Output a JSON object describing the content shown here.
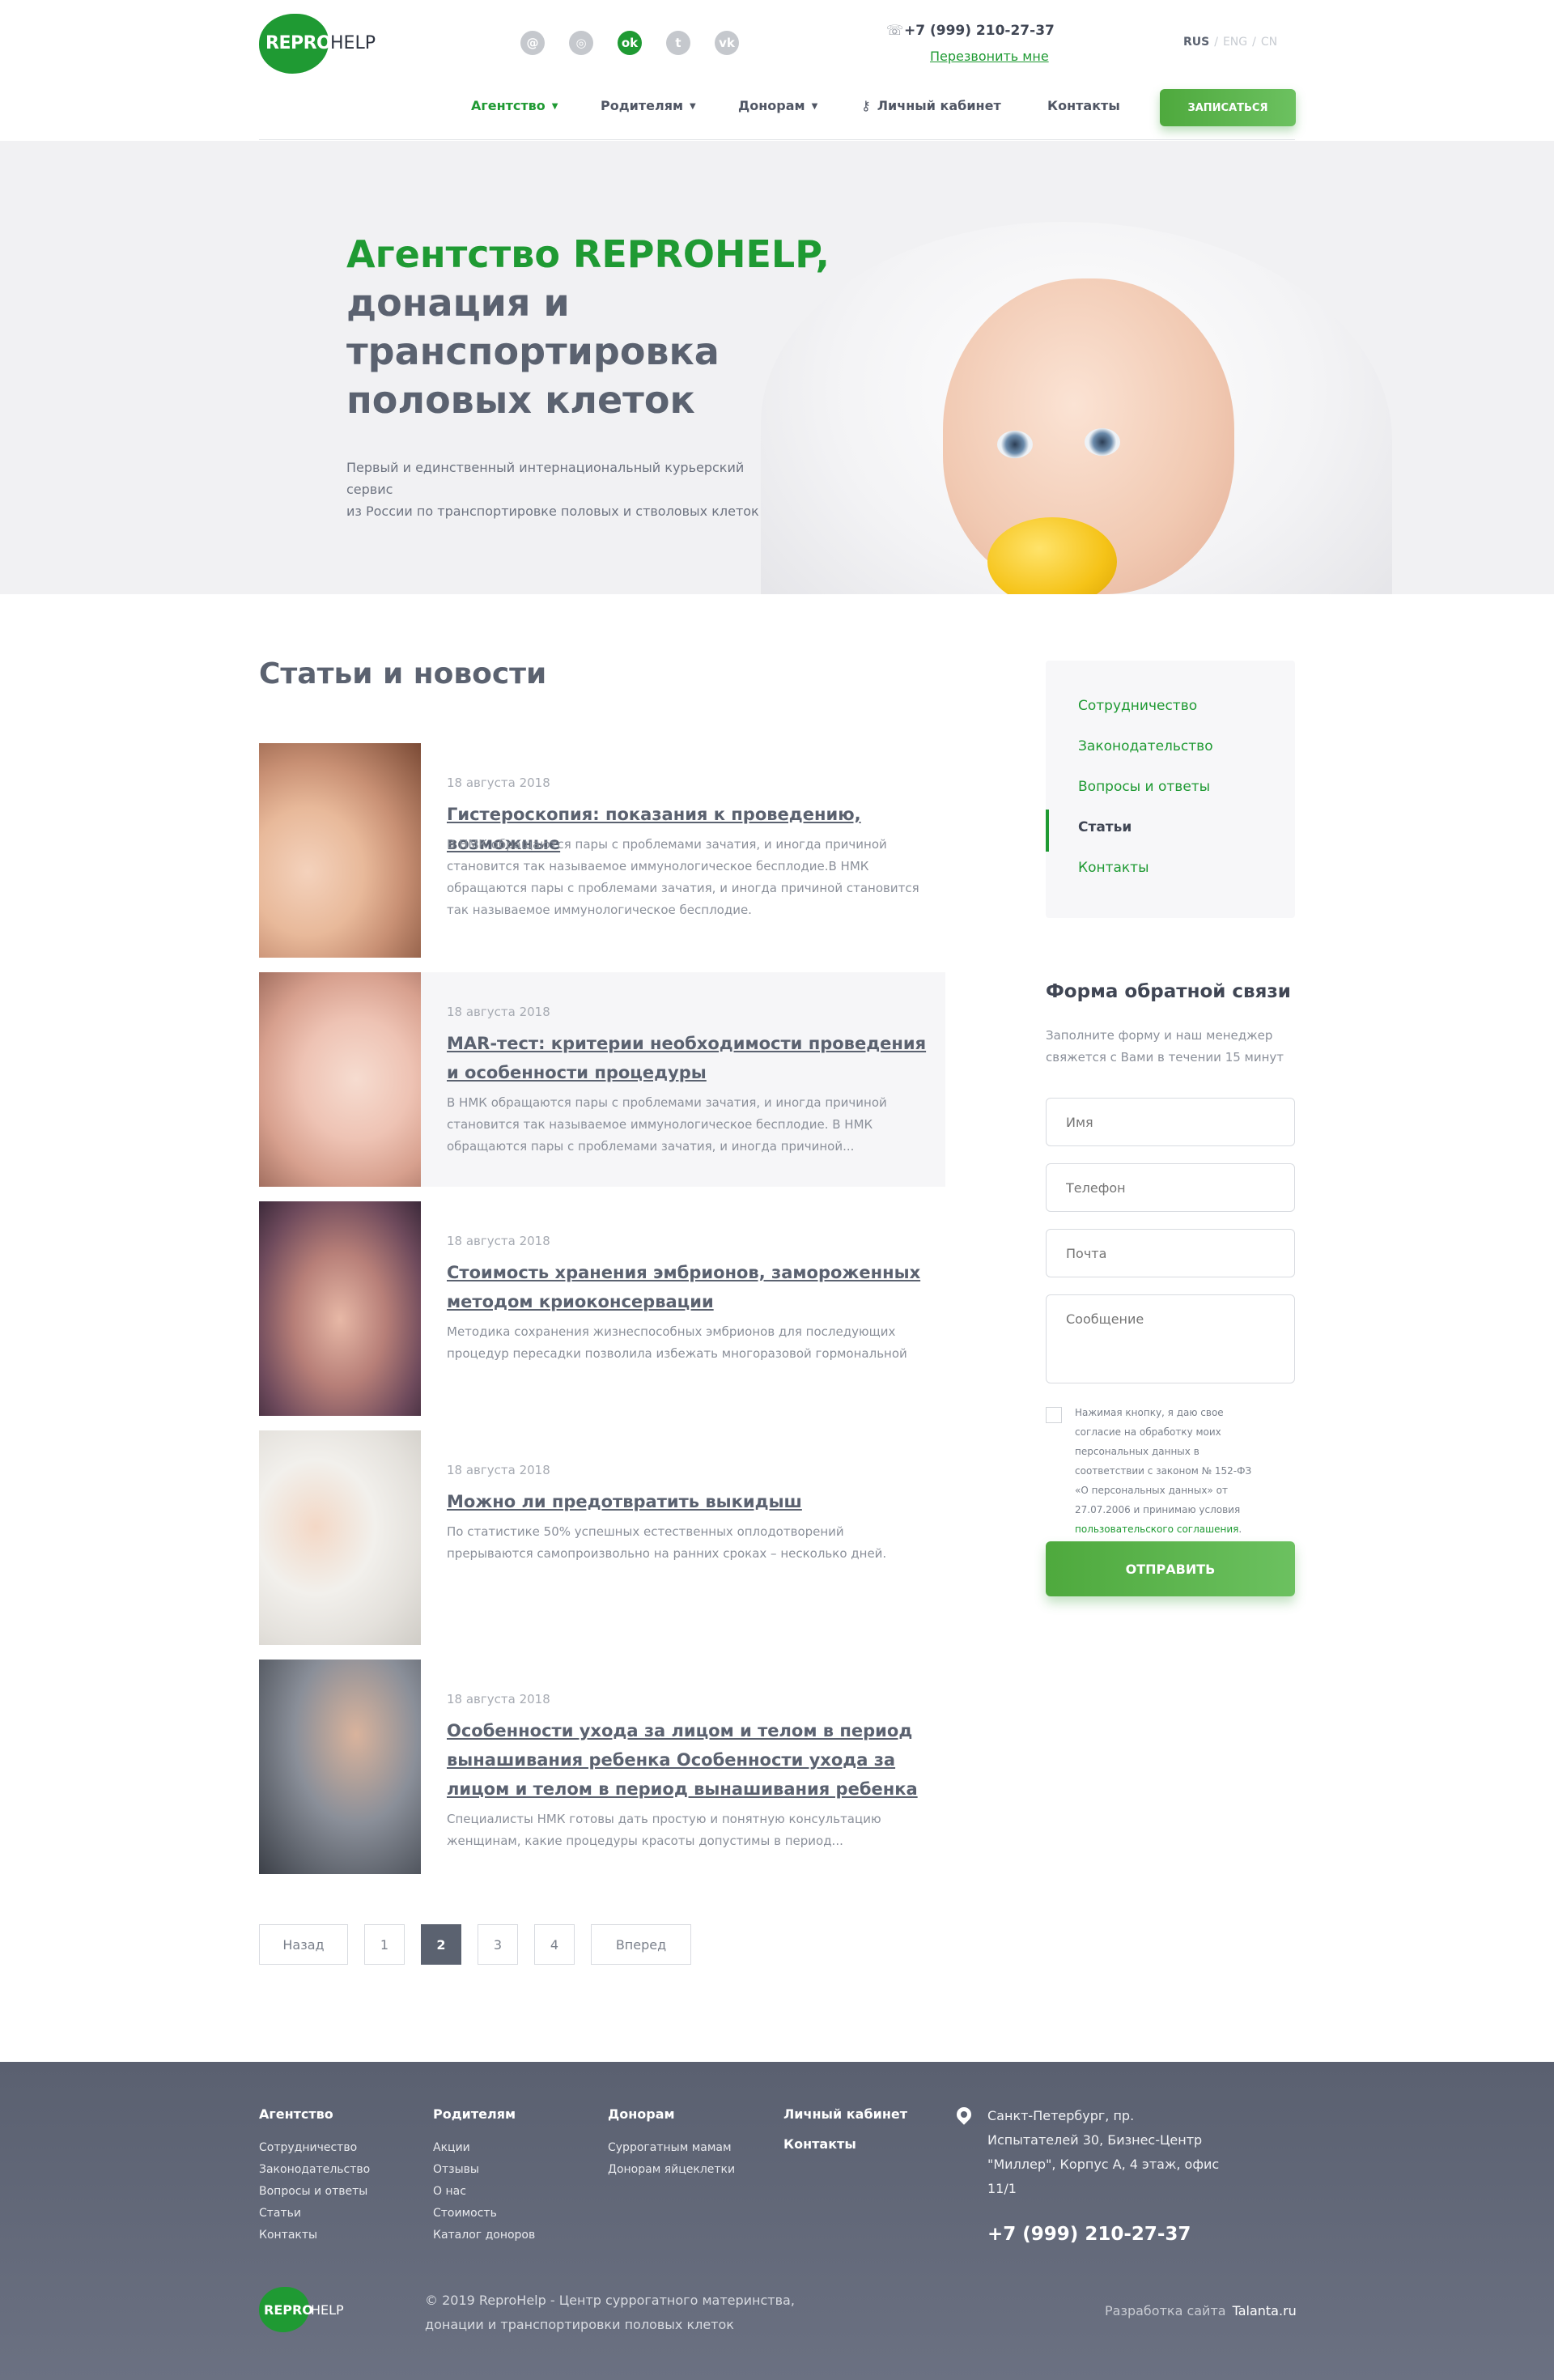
{
  "header": {
    "logo": {
      "repro": "REPRO",
      "help": "HELP"
    },
    "social": [
      {
        "icon": "at-icon",
        "glyph": "@",
        "active": false
      },
      {
        "icon": "instagram-icon",
        "glyph": "◎",
        "active": false
      },
      {
        "icon": "odnoklassniki-icon",
        "glyph": "ok",
        "active": true
      },
      {
        "icon": "twitter-icon",
        "glyph": "t",
        "active": false
      },
      {
        "icon": "vk-icon",
        "glyph": "vk",
        "active": false
      }
    ],
    "phone": "+7 (999) 210-27-37",
    "callback": "Перезвонить мне",
    "langs": {
      "rus": "RUS",
      "eng": "ENG",
      "cn": "CN",
      "sep": "/"
    },
    "nav": [
      {
        "label": "Агентство",
        "dropdown": true,
        "active": true
      },
      {
        "label": "Родителям",
        "dropdown": true,
        "active": false
      },
      {
        "label": "Донорам",
        "dropdown": true,
        "active": false
      },
      {
        "label": "Личный кабинет",
        "dropdown": false,
        "active": false
      },
      {
        "label": "Контакты",
        "dropdown": false,
        "active": false
      }
    ],
    "signup": "ЗАПИСАТЬСЯ"
  },
  "hero": {
    "title_green": "Агентство REPROHELP,",
    "title_line2": "донация и",
    "title_line3": "транспортировка",
    "title_line4": "половых клеток",
    "subtitle_line1": "Первый и единственный интернациональный курьерский сервис",
    "subtitle_line2": "из России по транспортировке половых и стволовых клеток"
  },
  "main": {
    "title": "Статьи и новости",
    "articles": [
      {
        "date": "18 августа 2018",
        "title": "Гистероскопия: показания к проведению, возможные",
        "desc": "В НМК обращаются пары с проблемами зачатия, и иногда причиной становится так называемое иммунологическое бесплодие.В НМК обращаются пары с проблемами зачатия, и иногда причиной становится так называемое иммунологическое бесплодие."
      },
      {
        "date": "18 августа 2018",
        "title": "MAR-тест: критерии необходимости проведения и особенности процедуры",
        "desc": "В НМК обращаются пары с проблемами зачатия, и иногда причиной становится так называемое иммунологическое бесплодие. В НМК обращаются пары с проблемами зачатия, и иногда причиной..."
      },
      {
        "date": "18 августа 2018",
        "title": "Стоимость хранения эмбрионов, замороженных методом криоконсервации",
        "desc": "Методика сохранения жизнеспособных эмбрионов для последующих процедур пересадки позволила избежать многоразовой гормональной"
      },
      {
        "date": "18 августа 2018",
        "title": "Можно ли предотвратить выкидыш",
        "desc": "По статистике 50% успешных естественных оплодотворений прерываются самопроизвольно на ранних сроках – несколько дней."
      },
      {
        "date": "18 августа 2018",
        "title": "Особенности ухода за лицом и телом в период вынашивания ребенка Особенности ухода за лицом и телом в период вынашивания ребенка",
        "desc": "Специалисты НМК готовы дать простую и понятную консультацию женщинам, какие процедуры красоты допустимы в период..."
      }
    ],
    "pagination": {
      "prev": "Назад",
      "pages": [
        "1",
        "2",
        "3",
        "4"
      ],
      "current": "2",
      "next": "Вперед"
    }
  },
  "sidebar": {
    "menu": [
      "Сотрудничество",
      "Законодательство",
      "Вопросы и ответы",
      "Статьи",
      "Контакты"
    ],
    "current": "Статьи",
    "form": {
      "title": "Форма обратной связи",
      "subtitle": "Заполните форму и наш менеджер свяжется с Вами в течении 15 минут",
      "name_ph": "Имя",
      "phone_ph": "Телефон",
      "email_ph": "Почта",
      "message_ph": "Сообщение",
      "consent_text": "Нажимая кнопку, я даю свое согласие на обработку моих персональных данных в соответствии с законом № 152-ФЗ «О персональных данных» от 27.07.2006 и принимаю условия",
      "consent_link": "пользовательского соглашения",
      "consent_end": ".",
      "submit": "ОТПРАВИТЬ"
    }
  },
  "footer": {
    "col1": {
      "title": "Агентство",
      "links": [
        "Сотрудничество",
        "Законодательство",
        "Вопросы и ответы",
        "Статьи",
        "Контакты"
      ]
    },
    "col2": {
      "title": "Родителям",
      "links": [
        "Акции",
        "Отзывы",
        "О нас",
        "Стоимость",
        "Каталог доноров"
      ]
    },
    "col3": {
      "title": "Донорам",
      "links": [
        "Суррогатным мамам",
        "Донорам яйцеклетки"
      ]
    },
    "col4": {
      "title": "Личный кабинет",
      "title2": "Контакты"
    },
    "address": "Санкт-Петербург, пр. Испытателей 30, Бизнес-Центр \"Миллер\", Корпус А, 4 этаж, офис 11/1",
    "phone": "+7 (999) 210-27-37",
    "logo": {
      "repro": "REPRO",
      "help": "HELP"
    },
    "copyright": "© 2019 ReproHelp - Центр суррогатного материнства, донации и транспортировки половых клеток",
    "dev_label": "Разработка сайта",
    "dev_name": "Talanta.ru"
  },
  "colors": {
    "brand_green": "#1f9a33",
    "text_gray": "#5b6270",
    "footer_bg": "#5f6576"
  }
}
